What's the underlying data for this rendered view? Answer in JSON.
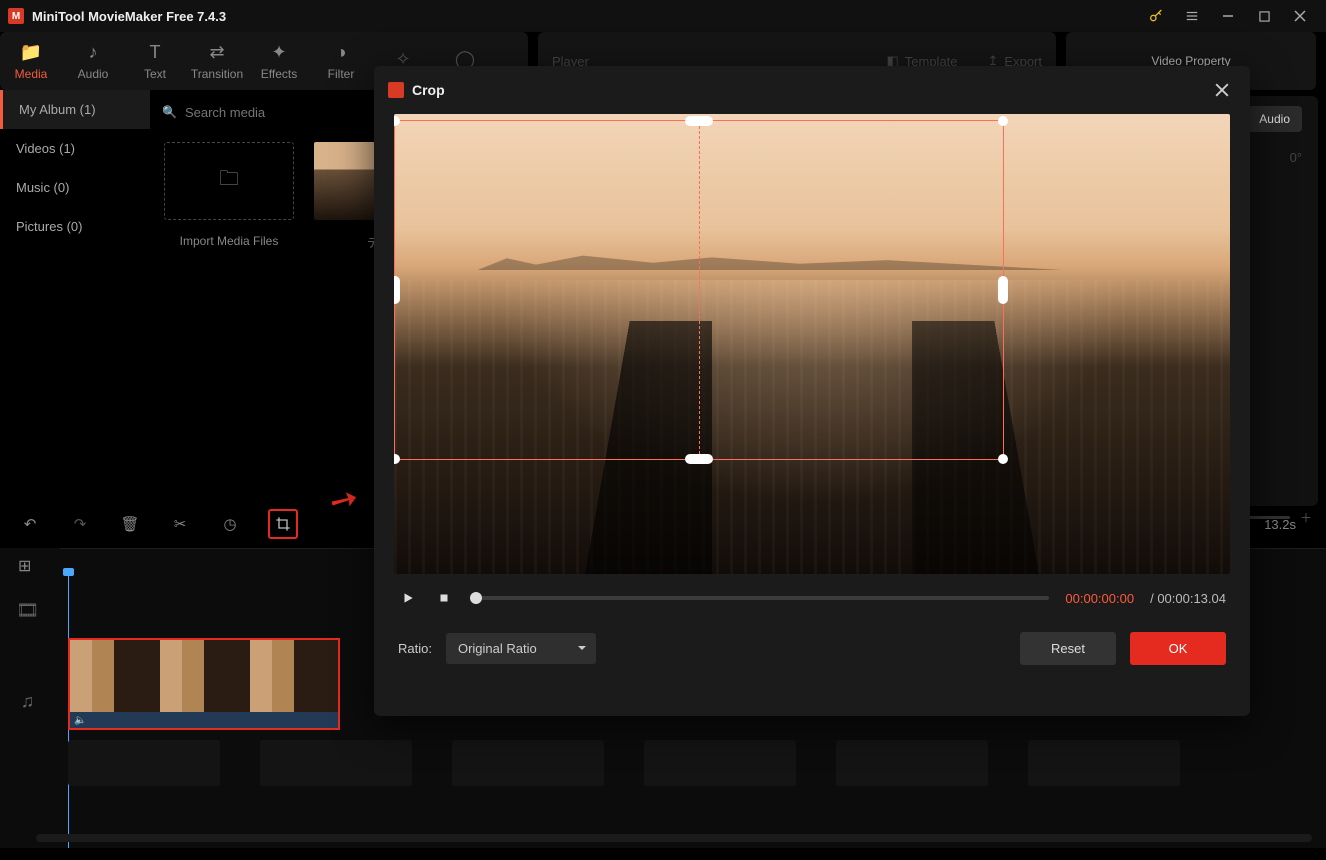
{
  "titlebar": {
    "app_name": "MiniTool MovieMaker Free 7.4.3"
  },
  "tabs": {
    "media": "Media",
    "audio": "Audio",
    "text": "Text",
    "transition": "Transition",
    "effects": "Effects",
    "filter": "Filter"
  },
  "player": {
    "label": "Player"
  },
  "export": {
    "template": "Template",
    "export": "Export",
    "video_property": "Video Property"
  },
  "sidebar": {
    "my_album": "My Album (1)",
    "videos": "Videos (1)",
    "music": "Music (0)",
    "pictures": "Pictures (0)"
  },
  "search": {
    "placeholder": "Search media"
  },
  "import_card": {
    "label": "Import Media Files"
  },
  "clip": {
    "name": "テス"
  },
  "right_panel": {
    "audio_tab": "Audio",
    "angle_hint": "0°"
  },
  "timeline": {
    "time_display": "13.2s"
  },
  "crop_modal": {
    "title": "Crop",
    "current_time": "00:00:00:00",
    "separator": " / ",
    "duration": "00:00:13.04",
    "ratio_label": "Ratio:",
    "ratio_value": "Original Ratio",
    "reset": "Reset",
    "ok": "OK"
  }
}
